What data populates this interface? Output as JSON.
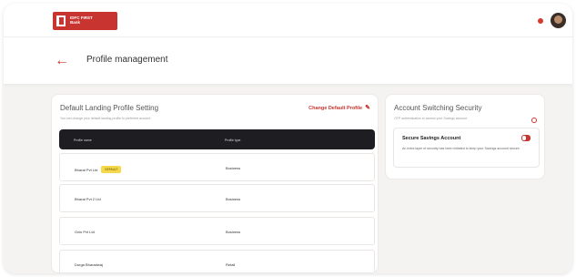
{
  "brand": {
    "logo_line1": "IDFC FIRST",
    "logo_line2": "Bank",
    "accent_color": "#c8342f"
  },
  "header": {
    "back_icon": "arrow-left-icon",
    "title": "Profile management"
  },
  "default_profile_card": {
    "title": "Default Landing Profile Setting",
    "subtitle": "You can change your default landing profile to preferred account",
    "change_link": "Change Default Profile",
    "change_icon": "pencil-icon",
    "columns": [
      "Profile name",
      "Profile type"
    ],
    "rows": [
      {
        "name": "Bharat Pvt Ltd",
        "badge": "DEFAULT",
        "type": "Business"
      },
      {
        "name": "Bharat Pvt 2 Ltd",
        "badge": "",
        "type": "Business"
      },
      {
        "name": "Oxin Pvt Ltd",
        "badge": "",
        "type": "Business"
      },
      {
        "name": "Durga Bharadwaj",
        "badge": "",
        "type": "Retail"
      }
    ]
  },
  "security_card": {
    "title": "Account Switching Security",
    "subtitle": "OTP authentication to access your Savings account",
    "item_title": "Secure Savings Account",
    "item_desc": "An extra layer of security has been initiated to keep your Savings account secure.",
    "toggle_on": true
  }
}
